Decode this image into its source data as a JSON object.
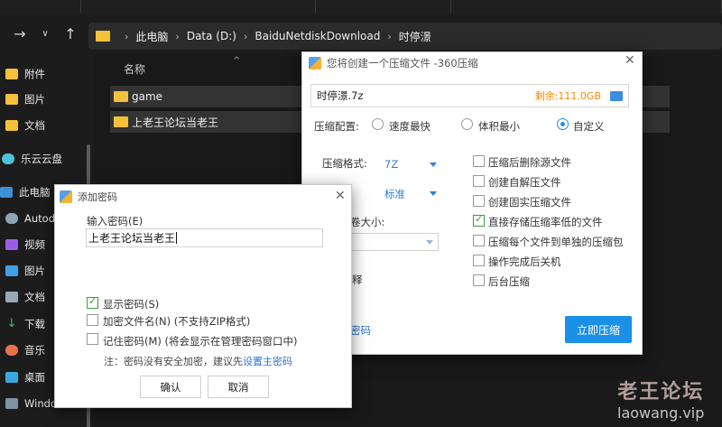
{
  "explorer": {
    "breadcrumb": [
      "此电脑",
      "Data (D:)",
      "BaiduNetdiskDownload",
      "时停澋"
    ],
    "column_header": "名称",
    "files": [
      "game",
      "上老王论坛当老王"
    ],
    "sidebar": [
      {
        "label": "附件",
        "icon": "folder-icon"
      },
      {
        "label": "图片",
        "icon": "folder-icon"
      },
      {
        "label": "文档",
        "icon": "folder-icon"
      },
      {
        "label": "乐云云盘",
        "icon": "cloud-icon"
      },
      {
        "label": "此电脑",
        "icon": "computer-icon"
      },
      {
        "label": "Autode",
        "icon": "drive-icon"
      },
      {
        "label": "视频",
        "icon": "video-icon"
      },
      {
        "label": "图片",
        "icon": "pictures-icon"
      },
      {
        "label": "文档",
        "icon": "documents-icon"
      },
      {
        "label": "下载",
        "icon": "download-icon"
      },
      {
        "label": "音乐",
        "icon": "music-icon"
      },
      {
        "label": "桌面",
        "icon": "desktop-icon"
      },
      {
        "label": "Window",
        "icon": "windows-drive-icon"
      }
    ]
  },
  "compress": {
    "title": "您将创建一个压缩文件 -360压缩",
    "filename": "时停澋.7z",
    "free_space": "剩余:111.0GB",
    "config_label": "压缩配置:",
    "options": [
      "速度最快",
      "体积最小",
      "自定义"
    ],
    "selected_option": "自定义",
    "format_label": "压缩格式:",
    "format_value": "7Z",
    "method_label_partial": "式:",
    "method_value": "标准",
    "volume_label_partial": "卷大小:",
    "comment_button_partial": "释",
    "password_link_partial": "密码",
    "checkboxes": [
      {
        "label": "压缩后删除源文件",
        "checked": false
      },
      {
        "label": "创建自解压文件",
        "checked": false
      },
      {
        "label": "创建固实压缩文件",
        "checked": false
      },
      {
        "label": "直接存储压缩率低的文件",
        "checked": true
      },
      {
        "label": "压缩每个文件到单独的压缩包",
        "checked": false
      },
      {
        "label": "操作完成后关机",
        "checked": false
      },
      {
        "label": "后台压缩",
        "checked": false
      }
    ],
    "submit_label": "立即压缩"
  },
  "password": {
    "title": "添加密码",
    "input_label": "输入密码(E)",
    "input_value": "上老王论坛当老王",
    "checkboxes": [
      {
        "label": "显示密码(S)",
        "checked": true
      },
      {
        "label": "加密文件名(N) (不支持ZIP格式)",
        "checked": false
      },
      {
        "label": "记住密码(M) (将会显示在管理密码窗口中)",
        "checked": false
      }
    ],
    "note_prefix": "注：密码没有安全加密，建议先",
    "note_link": "设置主密码",
    "ok_label": "确认",
    "cancel_label": "取消"
  },
  "watermark": {
    "name": "老王论坛",
    "url": "laowang.vip"
  },
  "colors": {
    "accent": "#1a90e6",
    "free_space": "#f28a00",
    "folder": "#f3c13a"
  }
}
